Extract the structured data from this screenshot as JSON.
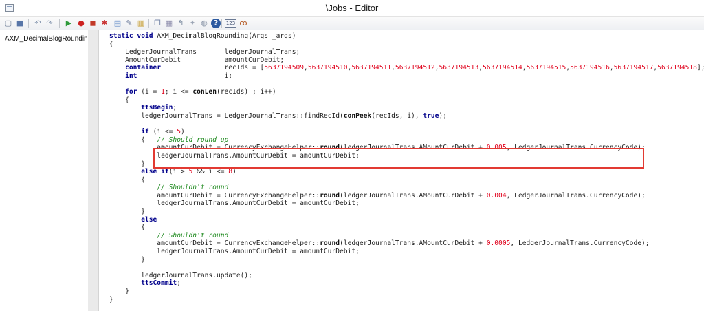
{
  "window": {
    "title": "\\Jobs - Editor"
  },
  "toolbar": {
    "buttons": [
      {
        "name": "new-icon",
        "glyph": "▢",
        "color": "#6e7e96"
      },
      {
        "name": "save-icon",
        "glyph": "■",
        "color": "#5876a8"
      },
      {
        "name": "undo-icon",
        "glyph": "↶",
        "color": "#7a8da8"
      },
      {
        "name": "redo-icon",
        "glyph": "↷",
        "color": "#7a8da8"
      },
      {
        "name": "run-icon",
        "glyph": "▶",
        "color": "#2e9a3a"
      },
      {
        "name": "breakpoint-icon",
        "glyph": "●",
        "color": "#cc2222"
      },
      {
        "name": "toggle-breakpoint-icon",
        "glyph": "◼",
        "color": "#c23a2a"
      },
      {
        "name": "remove-breakpoints-icon",
        "glyph": "✱",
        "color": "#c83030"
      },
      {
        "name": "compile-icon",
        "glyph": "▤",
        "color": "#4a7abf"
      },
      {
        "name": "lookup-icon",
        "glyph": "✎",
        "color": "#6a7a9a"
      },
      {
        "name": "script-icon",
        "glyph": "▥",
        "color": "#c49a2a"
      },
      {
        "name": "copy-icon",
        "glyph": "❐",
        "color": "#7788aa"
      },
      {
        "name": "paste-icon",
        "glyph": "▦",
        "color": "#8a8aaa"
      },
      {
        "name": "comment-icon",
        "glyph": "↰",
        "color": "#7a8aa0"
      },
      {
        "name": "uncomment-icon",
        "glyph": "✦",
        "color": "#9aa4b4"
      },
      {
        "name": "find-icon",
        "glyph": "◍",
        "color": "#8a96a8"
      },
      {
        "name": "help-icon",
        "glyph": "?",
        "color": "#ffffff"
      },
      {
        "name": "line-number-icon",
        "glyph": "123",
        "color": "#3a4a6a"
      },
      {
        "name": "script-wizard-icon",
        "glyph": "ꝏ",
        "color": "#b3561f"
      }
    ]
  },
  "sidebar": {
    "items": [
      {
        "label": "AXM_DecimalBlogRounding"
      }
    ]
  },
  "editor": {
    "lines": [
      [
        {
          "t": "static void ",
          "c": "kw"
        },
        {
          "t": "AXM_DecimalBlogRounding(Args _args)"
        }
      ],
      [
        {
          "t": "{"
        }
      ],
      [
        {
          "t": "    LedgerJournalTrans       ledgerJournalTrans;"
        }
      ],
      [
        {
          "t": "    AmountCurDebit           amountCurDebit;"
        }
      ],
      [
        {
          "t": "    container",
          "c": "kw"
        },
        {
          "t": "                recIds = ["
        },
        {
          "t": "5637194509",
          "c": "num"
        },
        {
          "t": ","
        },
        {
          "t": "5637194510",
          "c": "num"
        },
        {
          "t": ","
        },
        {
          "t": "5637194511",
          "c": "num"
        },
        {
          "t": ","
        },
        {
          "t": "5637194512",
          "c": "num"
        },
        {
          "t": ","
        },
        {
          "t": "5637194513",
          "c": "num"
        },
        {
          "t": ","
        },
        {
          "t": "5637194514",
          "c": "num"
        },
        {
          "t": ","
        },
        {
          "t": "5637194515",
          "c": "num"
        },
        {
          "t": ","
        },
        {
          "t": "5637194516",
          "c": "num"
        },
        {
          "t": ","
        },
        {
          "t": "5637194517",
          "c": "num"
        },
        {
          "t": ","
        },
        {
          "t": "5637194518",
          "c": "num"
        },
        {
          "t": "];"
        }
      ],
      [
        {
          "t": "    int",
          "c": "kw"
        },
        {
          "t": "                      i;"
        }
      ],
      [
        {
          "t": ""
        }
      ],
      [
        {
          "t": "    for",
          "c": "kw"
        },
        {
          "t": " (i = "
        },
        {
          "t": "1",
          "c": "num"
        },
        {
          "t": "; i <= "
        },
        {
          "t": "conLen",
          "c": "fnb"
        },
        {
          "t": "(recIds) ; i++)"
        }
      ],
      [
        {
          "t": "    {"
        }
      ],
      [
        {
          "t": "        ttsBegin",
          "c": "kw"
        },
        {
          "t": ";"
        }
      ],
      [
        {
          "t": "        ledgerJournalTrans = LedgerJournalTrans::findRecId("
        },
        {
          "t": "conPeek",
          "c": "fnb"
        },
        {
          "t": "(recIds, i), "
        },
        {
          "t": "true",
          "c": "kw"
        },
        {
          "t": ");"
        }
      ],
      [
        {
          "t": ""
        }
      ],
      [
        {
          "t": "        if",
          "c": "kw"
        },
        {
          "t": " (i <= "
        },
        {
          "t": "5",
          "c": "num"
        },
        {
          "t": ")"
        }
      ],
      [
        {
          "t": "        {   "
        },
        {
          "t": "// Should round up",
          "c": "cm"
        }
      ],
      [
        {
          "t": "            amountCurDebit = CurrencyExchangeHelper::"
        },
        {
          "t": "round",
          "c": "fnb"
        },
        {
          "t": "(ledgerJournalTrans.AMountCurDebit + "
        },
        {
          "t": "0.005",
          "c": "num"
        },
        {
          "t": ", LedgerJournalTrans.CurrencyCode);"
        }
      ],
      [
        {
          "t": "            ledgerJournalTrans.AmountCurDebit = amountCurDebit;"
        }
      ],
      [
        {
          "t": "        }"
        }
      ],
      [
        {
          "t": "        else if",
          "c": "kw"
        },
        {
          "t": "(i > "
        },
        {
          "t": "5",
          "c": "num"
        },
        {
          "t": " && i <= "
        },
        {
          "t": "8",
          "c": "num"
        },
        {
          "t": ")"
        }
      ],
      [
        {
          "t": "        {"
        }
      ],
      [
        {
          "t": "            "
        },
        {
          "t": "// Shouldn't round",
          "c": "cm"
        }
      ],
      [
        {
          "t": "            amountCurDebit = CurrencyExchangeHelper::"
        },
        {
          "t": "round",
          "c": "fnb"
        },
        {
          "t": "(ledgerJournalTrans.AMountCurDebit + "
        },
        {
          "t": "0.004",
          "c": "num"
        },
        {
          "t": ", LedgerJournalTrans.CurrencyCode);"
        }
      ],
      [
        {
          "t": "            ledgerJournalTrans.AmountCurDebit = amountCurDebit;"
        }
      ],
      [
        {
          "t": "        }"
        }
      ],
      [
        {
          "t": "        else",
          "c": "kw"
        }
      ],
      [
        {
          "t": "        {"
        }
      ],
      [
        {
          "t": "            "
        },
        {
          "t": "// Shouldn't round",
          "c": "cm"
        }
      ],
      [
        {
          "t": "            amountCurDebit = CurrencyExchangeHelper::"
        },
        {
          "t": "round",
          "c": "fnb"
        },
        {
          "t": "(ledgerJournalTrans.AMountCurDebit + "
        },
        {
          "t": "0.0005",
          "c": "num"
        },
        {
          "t": ", LedgerJournalTrans.CurrencyCode);"
        }
      ],
      [
        {
          "t": "            ledgerJournalTrans.AmountCurDebit = amountCurDebit;"
        }
      ],
      [
        {
          "t": "        }"
        }
      ],
      [
        {
          "t": ""
        }
      ],
      [
        {
          "t": "        ledgerJournalTrans.update();"
        }
      ],
      [
        {
          "t": "        ttsCommit",
          "c": "kw"
        },
        {
          "t": ";"
        }
      ],
      [
        {
          "t": "    }"
        }
      ],
      [
        {
          "t": "}"
        }
      ]
    ],
    "highlight_color": "#e23a32"
  }
}
